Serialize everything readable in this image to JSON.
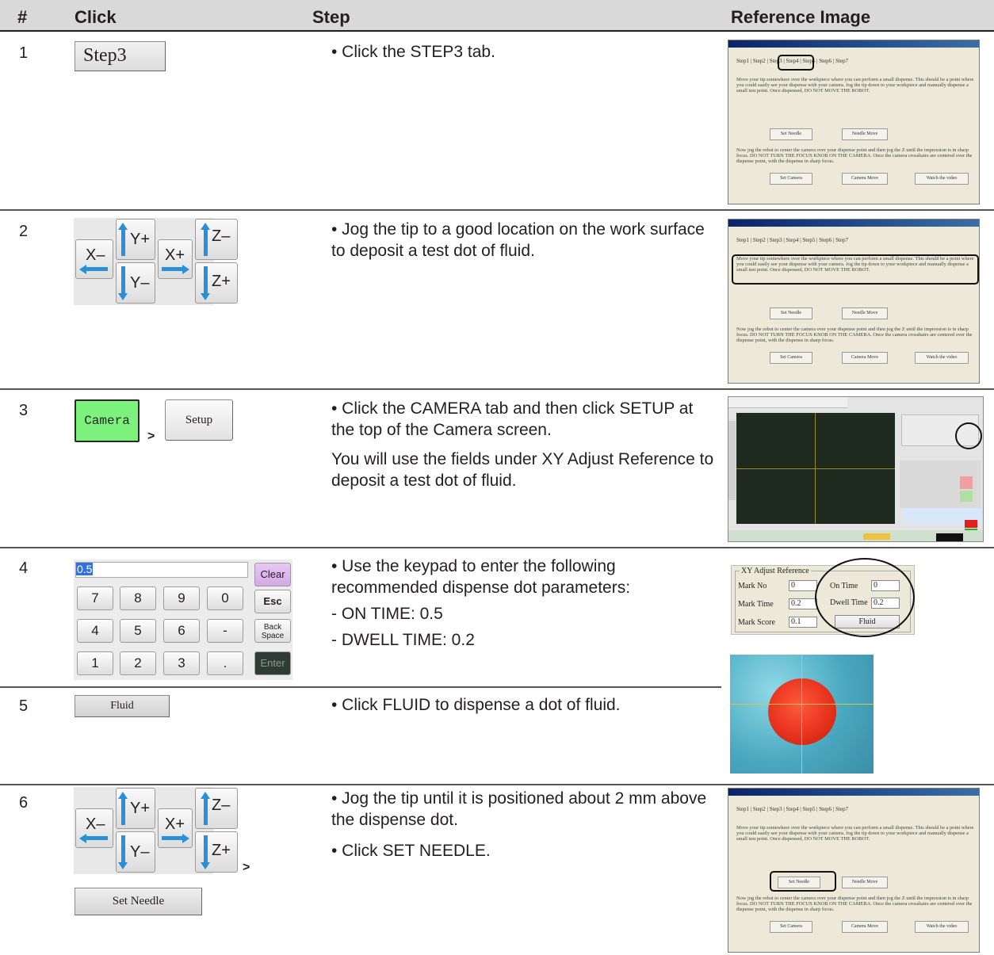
{
  "header": {
    "col_num": "#",
    "col_click": "Click",
    "col_step": "Step",
    "col_ref": "Reference Image"
  },
  "rows": [
    {
      "num": "1",
      "click_label": "Step3",
      "steps": [
        "• Click the STEP3 tab."
      ]
    },
    {
      "num": "2",
      "steps": [
        "• Jog the tip to a good location on the work surface to deposit a test dot of fluid."
      ]
    },
    {
      "num": "3",
      "click_camera": "Camera",
      "click_setup": "Setup",
      "separator": ">",
      "steps": [
        "• Click the CAMERA tab and then click SETUP at the top of the Camera screen.",
        "You will use the fields under XY Adjust Reference to deposit a test dot of fluid."
      ]
    },
    {
      "num": "4",
      "steps": [
        "• Use the keypad to enter the following recommended dispense dot parameters:",
        "-  ON TIME: 0.5",
        "-  DWELL TIME: 0.2"
      ]
    },
    {
      "num": "5",
      "click_label": "Fluid",
      "steps": [
        "• Click FLUID to dispense a dot of fluid."
      ]
    },
    {
      "num": "6",
      "click_label": "Set Needle",
      "separator": ">",
      "steps": [
        "• Jog the tip until it is positioned about 2 mm above the dispense dot.",
        "• Click SET NEEDLE."
      ]
    }
  ],
  "jog": {
    "x_minus": "X–",
    "x_plus": "X+",
    "y_plus": "Y+",
    "y_minus": "Y–",
    "z_minus": "Z–",
    "z_plus": "Z+"
  },
  "keypad": {
    "value": "0.5",
    "keys": [
      "7",
      "8",
      "9",
      "0",
      "4",
      "5",
      "6",
      "-",
      "1",
      "2",
      "3",
      "."
    ],
    "clear": "Clear",
    "esc": "Esc",
    "back_space": "Back Space",
    "enter": "Enter"
  },
  "ref_window": {
    "title": "Robot Setup Procedure",
    "tabs": "Step1 | Step2 | Step3 | Step4 | Step5 | Step6 | Step7",
    "para1": "Move your tip somewhere over the workpiece where you can perform a small dispense. This should be a point where you could easily see your dispense with your camera. Jog the tip down to your workpiece and manually dispense a small test point. Once dispensed, DO NOT MOVE THE ROBOT.",
    "para2": "Now jog the robot to center the camera over your dispense point and then jog the Z until the impression is in sharp focus. DO NOT TURN THE FOCUS KNOB ON THE CAMERA. Once the camera crosshairs are centered over the dispense point, with the dispense in sharp focus.",
    "set_needle": "Set Needle",
    "needle_move": "Needle Move",
    "set_camera": "Set Camera",
    "camera_move": "Camera Move",
    "watch_video": "Watch the video"
  },
  "xy_adjust": {
    "title": "XY Adjust Reference",
    "mark_no": "Mark No",
    "mark_no_val": "0",
    "mark_time": "Mark Time",
    "mark_time_val": "0.2",
    "mark_score": "Mark Score",
    "mark_score_val": "0.1",
    "on_time": "On Time",
    "on_time_val": "0",
    "dwell_time": "Dwell Time",
    "dwell_time_val": "0.2",
    "fluid": "Fluid"
  },
  "colors": {
    "header_bg": "#d9d9d9",
    "jog_arrow": "#2a8fd6",
    "camera_btn": "#7cf27c",
    "clear_key": "#d9b3e6",
    "dot": "#e8331e"
  }
}
